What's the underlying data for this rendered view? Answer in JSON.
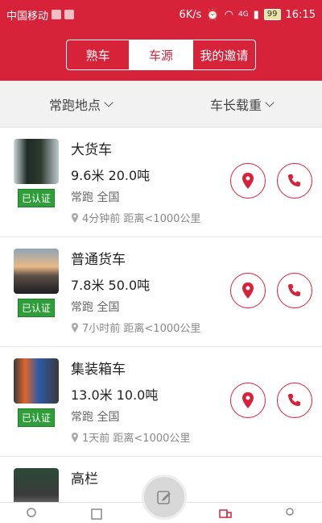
{
  "status_bar": {
    "carrier": "中国移动",
    "speed": "6K/s",
    "network": "4G",
    "battery": "99",
    "time": "16:15"
  },
  "tabs": [
    {
      "label": "熟车",
      "active": false
    },
    {
      "label": "车源",
      "active": true
    },
    {
      "label": "我的邀请",
      "active": false
    }
  ],
  "filters": {
    "location": "常跑地点",
    "length_load": "车长载重"
  },
  "badge_label": "已认证",
  "listings": [
    {
      "name": "大货车",
      "spec": "9.6米 20.0吨",
      "route": "常跑 全国",
      "meta": "4分钟前 距离<1000公里"
    },
    {
      "name": "普通货车",
      "spec": "7.8米 50.0吨",
      "route": "常跑 全国",
      "meta": "7小时前 距离<1000公里"
    },
    {
      "name": "集装箱车",
      "spec": "13.0米 10.0吨",
      "route": "常跑 全国",
      "meta": "1天前 距离<1000公里"
    },
    {
      "name": "高栏",
      "spec": "",
      "route": "",
      "meta": ""
    }
  ],
  "colors": {
    "brand": "#d7233a",
    "verified": "#2f9e3a"
  }
}
